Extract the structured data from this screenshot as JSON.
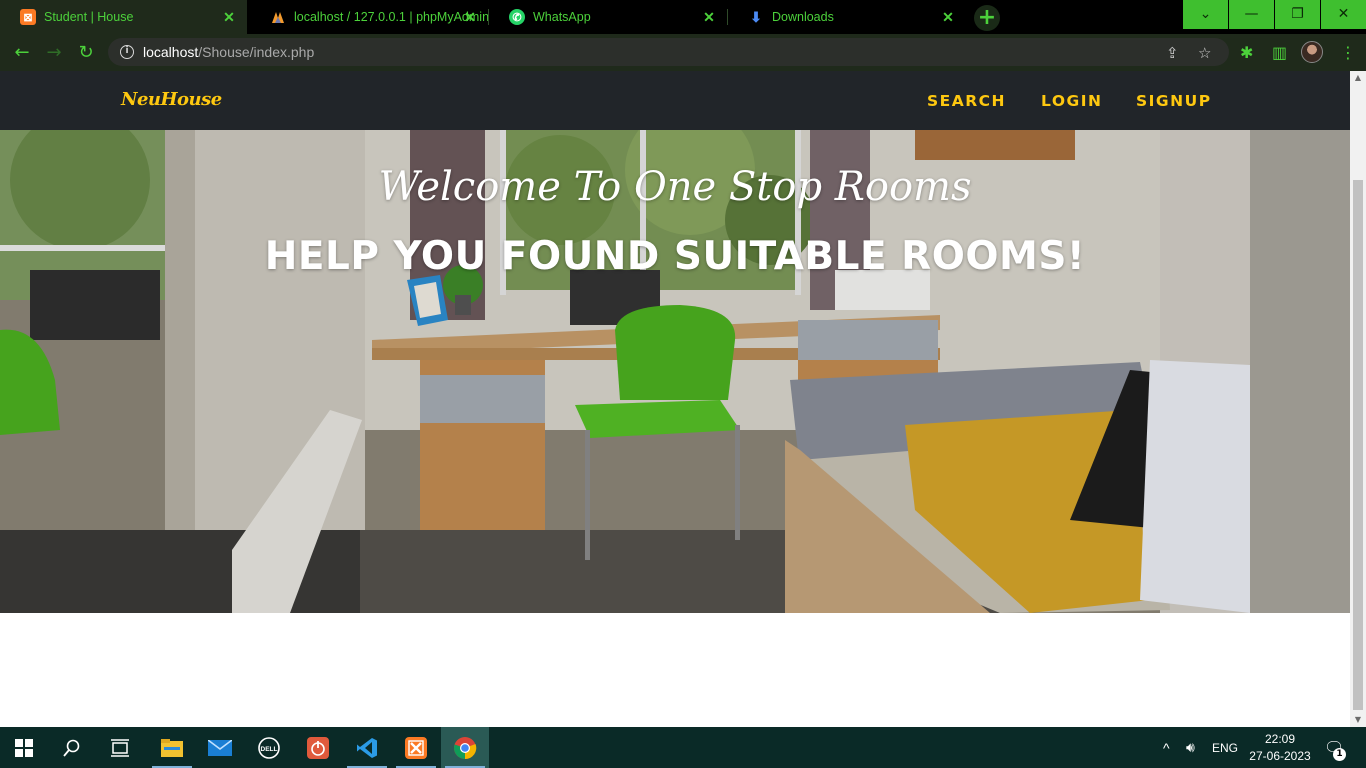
{
  "browser": {
    "tabs": [
      {
        "title": "Student | House",
        "favicon": "xampp-icon",
        "active": true
      },
      {
        "title": "localhost / 127.0.0.1 | phpMyAdmin",
        "favicon": "phpmyadmin-icon",
        "active": false
      },
      {
        "title": "WhatsApp",
        "favicon": "whatsapp-icon",
        "active": false
      },
      {
        "title": "Downloads",
        "favicon": "download-icon",
        "active": false
      }
    ],
    "url": {
      "host": "localhost",
      "path": "/Shouse/index.php"
    },
    "accent_color": "#4cd13b"
  },
  "site": {
    "brand": "NeuHouse",
    "nav": [
      "SEARCH",
      "LOGIN",
      "SIGNUP"
    ],
    "nav_color": "#fec810",
    "hero": {
      "subheading": "Welcome To One Stop Rooms",
      "heading": "HELP YOU FOUND SUITABLE ROOMS!"
    }
  },
  "taskbar": {
    "apps": [
      "start-icon",
      "search-icon",
      "task-view-icon",
      "file-explorer-icon",
      "mail-icon",
      "dell-icon",
      "power-app-icon",
      "vscode-icon",
      "xampp-icon",
      "chrome-icon"
    ],
    "language": "ENG",
    "time": "22:09",
    "date": "27-06-2023",
    "notifications": "1"
  }
}
